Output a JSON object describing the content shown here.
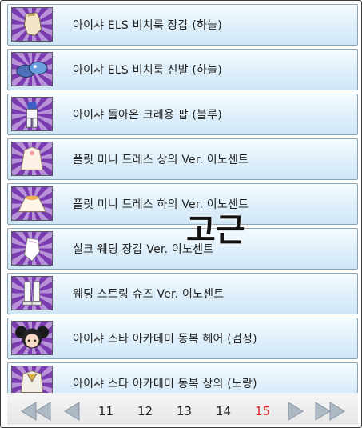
{
  "items": [
    {
      "label": "아이샤 ELS 비치룩 장갑 (하늘)",
      "icon": "glove-icon"
    },
    {
      "label": "아이샤 ELS 비치룩 신발 (하늘)",
      "icon": "sandals-icon"
    },
    {
      "label": "아이샤 돌아온 크레용 팝 (블루)",
      "icon": "outfit-icon"
    },
    {
      "label": "플릿 미니 드레스 상의 Ver. 이노센트",
      "icon": "dress-top-icon"
    },
    {
      "label": "플릿 미니 드레스 하의 Ver. 이노센트",
      "icon": "dress-skirt-icon"
    },
    {
      "label": "실크 웨딩 장갑 Ver. 이노센트",
      "icon": "silk-glove-icon"
    },
    {
      "label": "웨딩 스트링 슈즈 Ver. 이노센트",
      "icon": "boots-icon"
    },
    {
      "label": "아이샤 스타 아카데미 동복 헤어 (검정)",
      "icon": "hair-icon"
    },
    {
      "label": "아이샤 스타 아카데미 동복 상의 (노랑)",
      "icon": "uniform-top-icon"
    }
  ],
  "pagination": {
    "pages": [
      "11",
      "12",
      "13",
      "14",
      "15"
    ],
    "current": "15",
    "first_icon": "double-left-arrow-icon",
    "prev_icon": "left-arrow-icon",
    "next_icon": "right-arrow-icon",
    "last_icon": "double-right-arrow-icon"
  },
  "watermark": "고근",
  "colors": {
    "active_page": "#e02424",
    "row_bg": "#dcecf8",
    "icon_bg": "#7a3bb0"
  }
}
